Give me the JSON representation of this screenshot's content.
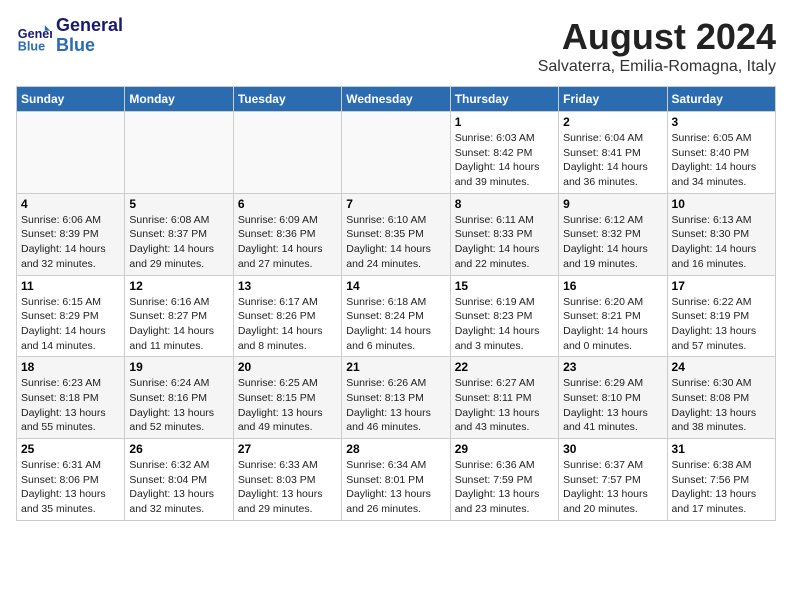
{
  "header": {
    "logo_line1": "General",
    "logo_line2": "Blue",
    "title": "August 2024",
    "subtitle": "Salvaterra, Emilia-Romagna, Italy"
  },
  "weekdays": [
    "Sunday",
    "Monday",
    "Tuesday",
    "Wednesday",
    "Thursday",
    "Friday",
    "Saturday"
  ],
  "weeks": [
    [
      {
        "day": "",
        "info": ""
      },
      {
        "day": "",
        "info": ""
      },
      {
        "day": "",
        "info": ""
      },
      {
        "day": "",
        "info": ""
      },
      {
        "day": "1",
        "info": "Sunrise: 6:03 AM\nSunset: 8:42 PM\nDaylight: 14 hours\nand 39 minutes."
      },
      {
        "day": "2",
        "info": "Sunrise: 6:04 AM\nSunset: 8:41 PM\nDaylight: 14 hours\nand 36 minutes."
      },
      {
        "day": "3",
        "info": "Sunrise: 6:05 AM\nSunset: 8:40 PM\nDaylight: 14 hours\nand 34 minutes."
      }
    ],
    [
      {
        "day": "4",
        "info": "Sunrise: 6:06 AM\nSunset: 8:39 PM\nDaylight: 14 hours\nand 32 minutes."
      },
      {
        "day": "5",
        "info": "Sunrise: 6:08 AM\nSunset: 8:37 PM\nDaylight: 14 hours\nand 29 minutes."
      },
      {
        "day": "6",
        "info": "Sunrise: 6:09 AM\nSunset: 8:36 PM\nDaylight: 14 hours\nand 27 minutes."
      },
      {
        "day": "7",
        "info": "Sunrise: 6:10 AM\nSunset: 8:35 PM\nDaylight: 14 hours\nand 24 minutes."
      },
      {
        "day": "8",
        "info": "Sunrise: 6:11 AM\nSunset: 8:33 PM\nDaylight: 14 hours\nand 22 minutes."
      },
      {
        "day": "9",
        "info": "Sunrise: 6:12 AM\nSunset: 8:32 PM\nDaylight: 14 hours\nand 19 minutes."
      },
      {
        "day": "10",
        "info": "Sunrise: 6:13 AM\nSunset: 8:30 PM\nDaylight: 14 hours\nand 16 minutes."
      }
    ],
    [
      {
        "day": "11",
        "info": "Sunrise: 6:15 AM\nSunset: 8:29 PM\nDaylight: 14 hours\nand 14 minutes."
      },
      {
        "day": "12",
        "info": "Sunrise: 6:16 AM\nSunset: 8:27 PM\nDaylight: 14 hours\nand 11 minutes."
      },
      {
        "day": "13",
        "info": "Sunrise: 6:17 AM\nSunset: 8:26 PM\nDaylight: 14 hours\nand 8 minutes."
      },
      {
        "day": "14",
        "info": "Sunrise: 6:18 AM\nSunset: 8:24 PM\nDaylight: 14 hours\nand 6 minutes."
      },
      {
        "day": "15",
        "info": "Sunrise: 6:19 AM\nSunset: 8:23 PM\nDaylight: 14 hours\nand 3 minutes."
      },
      {
        "day": "16",
        "info": "Sunrise: 6:20 AM\nSunset: 8:21 PM\nDaylight: 14 hours\nand 0 minutes."
      },
      {
        "day": "17",
        "info": "Sunrise: 6:22 AM\nSunset: 8:19 PM\nDaylight: 13 hours\nand 57 minutes."
      }
    ],
    [
      {
        "day": "18",
        "info": "Sunrise: 6:23 AM\nSunset: 8:18 PM\nDaylight: 13 hours\nand 55 minutes."
      },
      {
        "day": "19",
        "info": "Sunrise: 6:24 AM\nSunset: 8:16 PM\nDaylight: 13 hours\nand 52 minutes."
      },
      {
        "day": "20",
        "info": "Sunrise: 6:25 AM\nSunset: 8:15 PM\nDaylight: 13 hours\nand 49 minutes."
      },
      {
        "day": "21",
        "info": "Sunrise: 6:26 AM\nSunset: 8:13 PM\nDaylight: 13 hours\nand 46 minutes."
      },
      {
        "day": "22",
        "info": "Sunrise: 6:27 AM\nSunset: 8:11 PM\nDaylight: 13 hours\nand 43 minutes."
      },
      {
        "day": "23",
        "info": "Sunrise: 6:29 AM\nSunset: 8:10 PM\nDaylight: 13 hours\nand 41 minutes."
      },
      {
        "day": "24",
        "info": "Sunrise: 6:30 AM\nSunset: 8:08 PM\nDaylight: 13 hours\nand 38 minutes."
      }
    ],
    [
      {
        "day": "25",
        "info": "Sunrise: 6:31 AM\nSunset: 8:06 PM\nDaylight: 13 hours\nand 35 minutes."
      },
      {
        "day": "26",
        "info": "Sunrise: 6:32 AM\nSunset: 8:04 PM\nDaylight: 13 hours\nand 32 minutes."
      },
      {
        "day": "27",
        "info": "Sunrise: 6:33 AM\nSunset: 8:03 PM\nDaylight: 13 hours\nand 29 minutes."
      },
      {
        "day": "28",
        "info": "Sunrise: 6:34 AM\nSunset: 8:01 PM\nDaylight: 13 hours\nand 26 minutes."
      },
      {
        "day": "29",
        "info": "Sunrise: 6:36 AM\nSunset: 7:59 PM\nDaylight: 13 hours\nand 23 minutes."
      },
      {
        "day": "30",
        "info": "Sunrise: 6:37 AM\nSunset: 7:57 PM\nDaylight: 13 hours\nand 20 minutes."
      },
      {
        "day": "31",
        "info": "Sunrise: 6:38 AM\nSunset: 7:56 PM\nDaylight: 13 hours\nand 17 minutes."
      }
    ]
  ]
}
